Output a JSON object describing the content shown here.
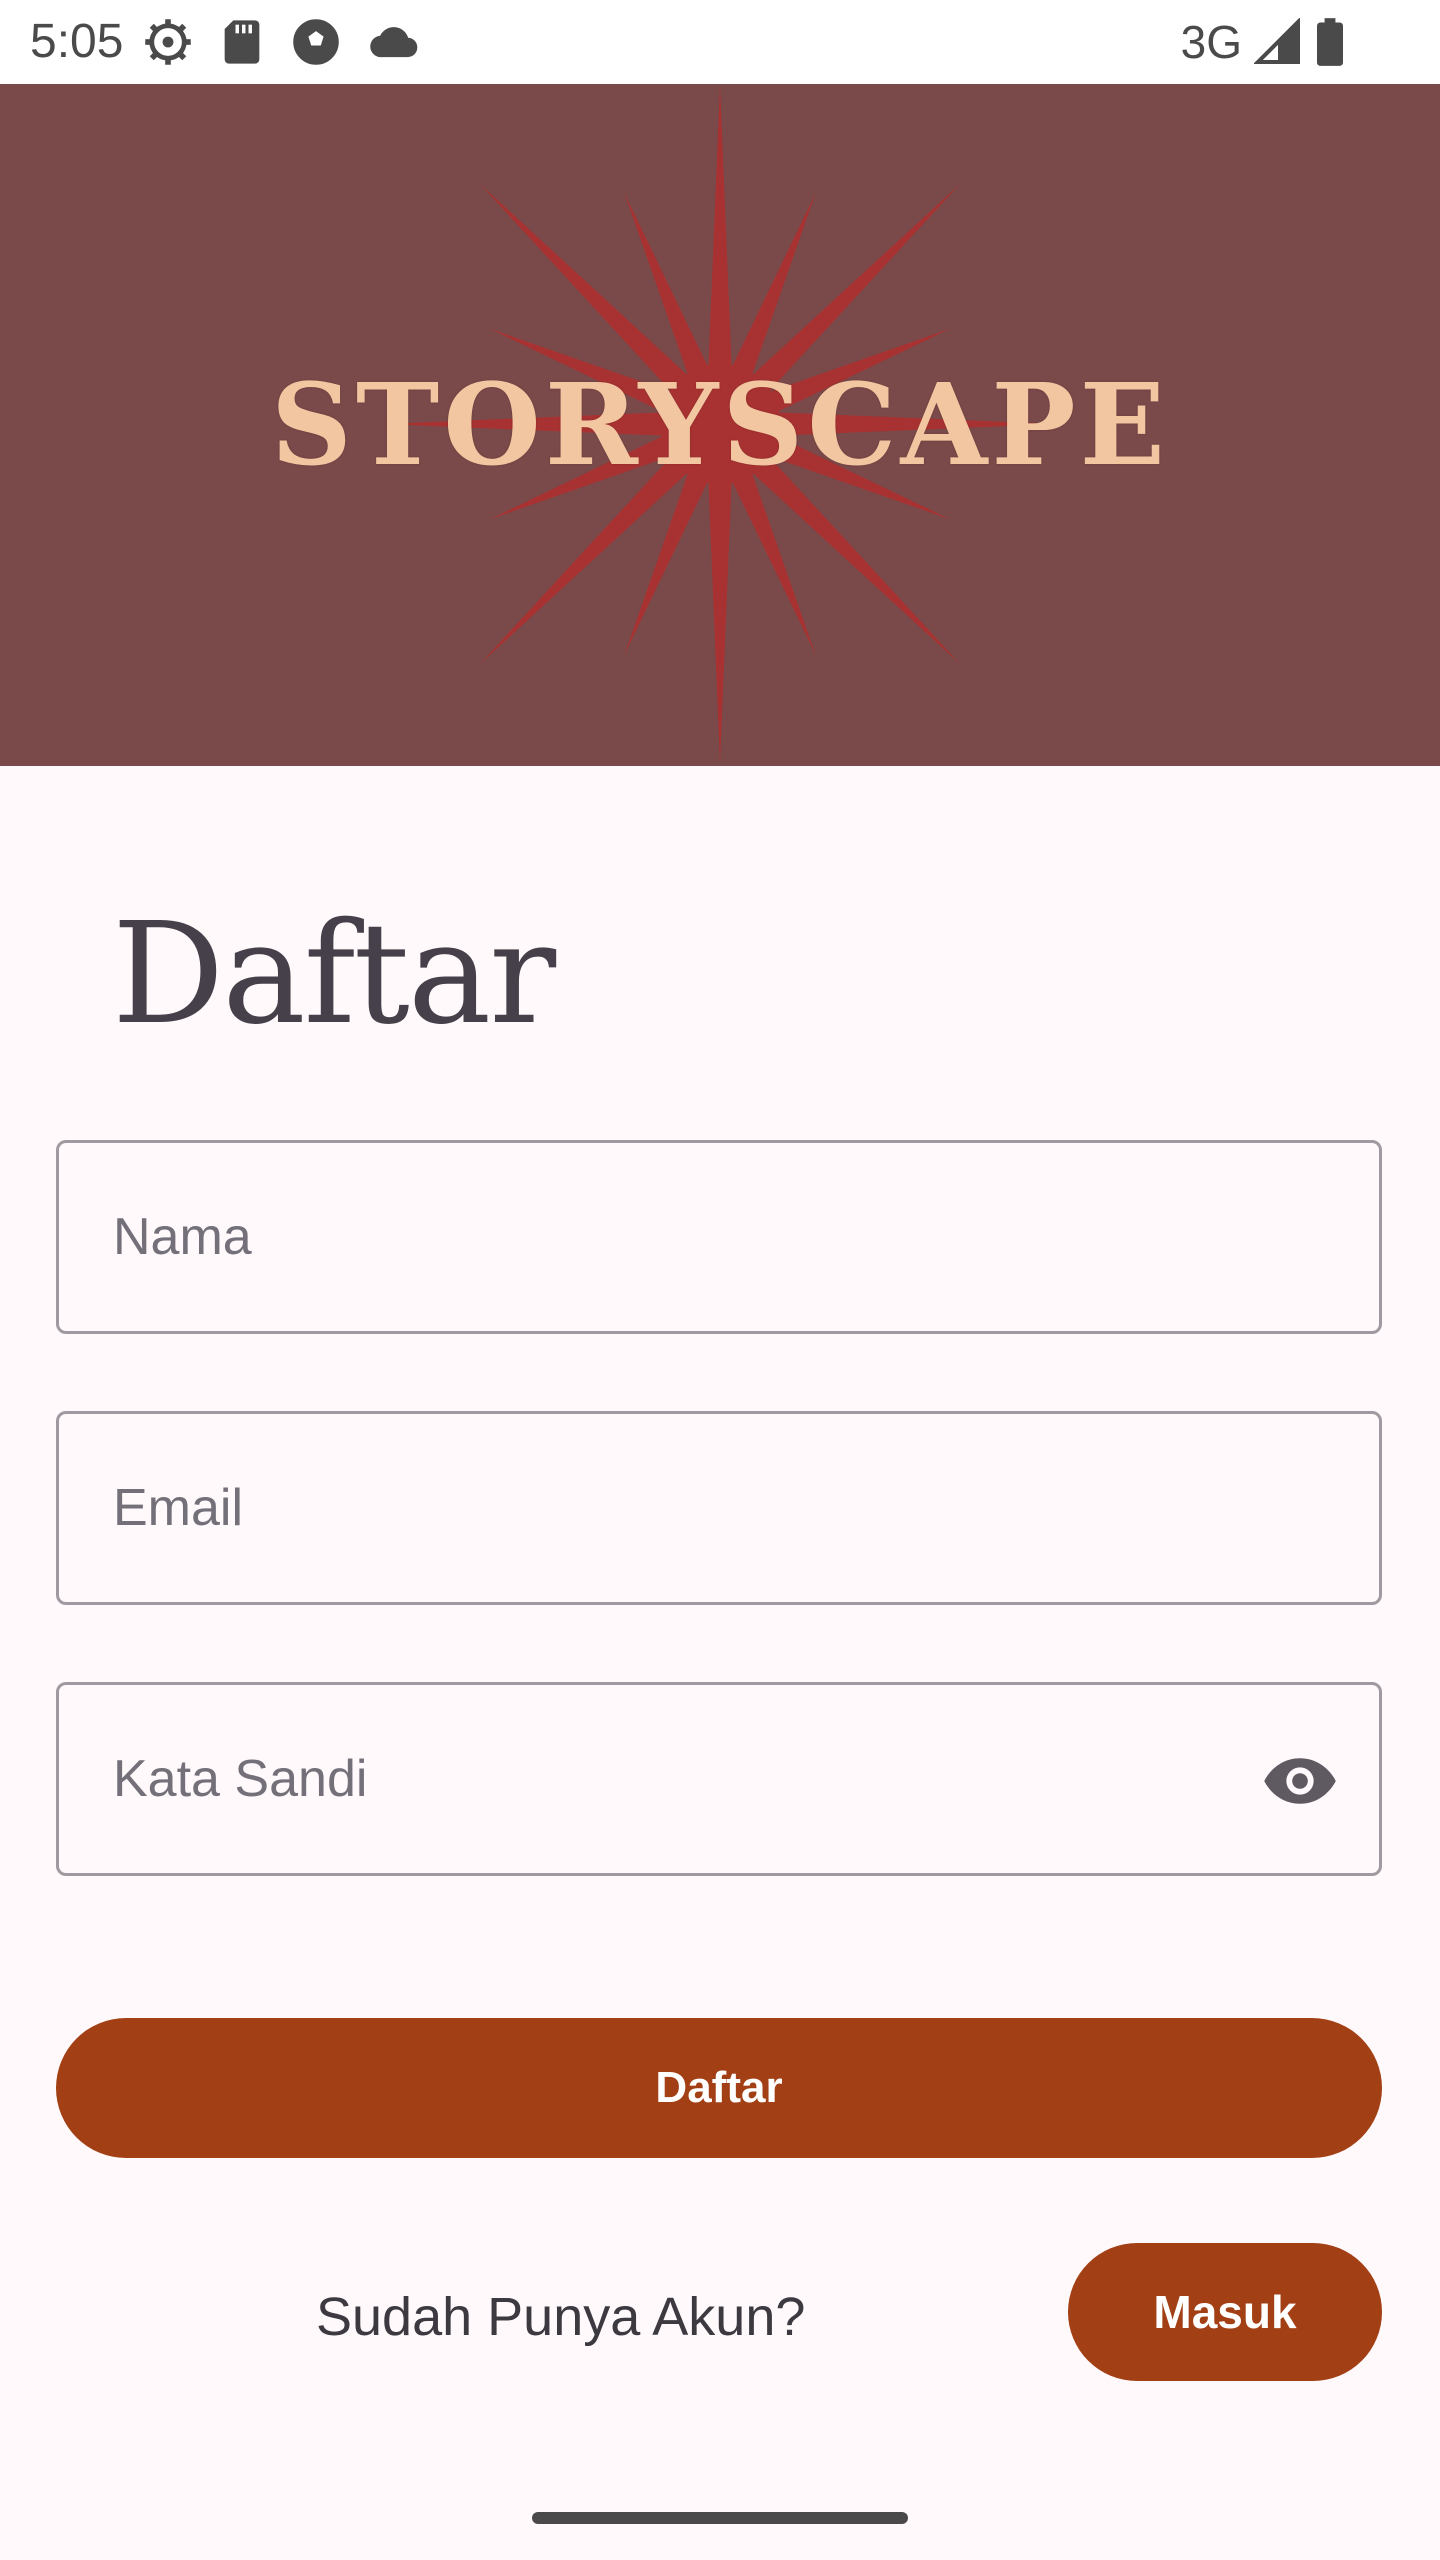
{
  "status_bar": {
    "time": "5:05",
    "network": "3G",
    "icons_left": [
      "settings-icon",
      "sd-card-icon",
      "soccer-ball-icon",
      "cloud-icon"
    ],
    "icons_right": [
      "signal-icon",
      "battery-icon"
    ]
  },
  "banner": {
    "logo_text": "STORYSCAPE",
    "background_color": "#7a4a4a",
    "star_color": "#a83232",
    "text_color": "#f2c6a0"
  },
  "form": {
    "title": "Daftar",
    "name_placeholder": "Nama",
    "email_placeholder": "Email",
    "password_placeholder": "Kata Sandi",
    "submit_label": "Daftar"
  },
  "footer": {
    "prompt": "Sudah Punya Akun?",
    "login_label": "Masuk"
  },
  "colors": {
    "accent": "#a23f14",
    "page_background": "#fff9fb"
  }
}
